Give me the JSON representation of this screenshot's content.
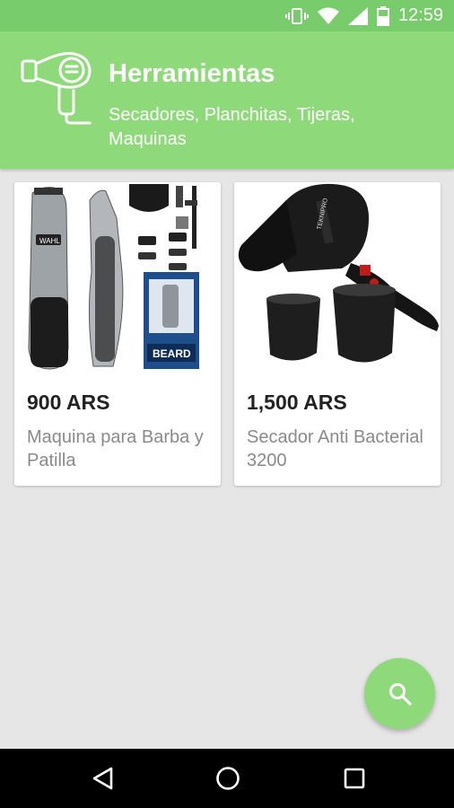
{
  "status_bar": {
    "time": "12:59",
    "icons": [
      "vibrate-icon",
      "wifi-icon",
      "signal-icon",
      "battery-icon"
    ]
  },
  "header": {
    "icon": "hair-dryer-icon",
    "title": "Herramientas",
    "subtitle": "Secadores, Planchitas, Tijeras, Maquinas"
  },
  "products": [
    {
      "image": "beard-trimmer-kit-image",
      "price": "900 ARS",
      "name": "Maquina para Barba y Patilla"
    },
    {
      "image": "hair-dryer-image",
      "price": "1,500 ARS",
      "name": "Secador Anti Bacterial 3200"
    }
  ],
  "product_image_text": {
    "brand": "WAHL",
    "kit_label": "BEARD",
    "dryer_brand": "TEKNIPRO"
  },
  "fab": {
    "icon": "search-icon"
  },
  "nav_bar": {
    "icons": [
      "back-icon",
      "home-icon",
      "recents-icon"
    ]
  },
  "colors": {
    "accent": "#8ed97a",
    "status_bar": "#79cc6b",
    "background": "#e6e6e6",
    "price_text": "#222222",
    "name_text": "#8a8a8a"
  }
}
